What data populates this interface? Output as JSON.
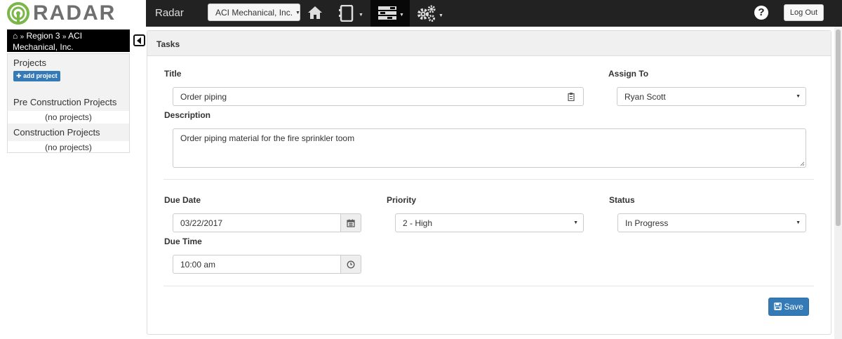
{
  "app": {
    "logo_text": "RADAR",
    "brand": "Radar",
    "company_selector": "ACI Mechanical, Inc.",
    "logout_label": "Log Out",
    "help_label": "?"
  },
  "nav": {
    "icons": [
      "home-icon",
      "device-icon",
      "list-icon",
      "gears-icon"
    ],
    "active": "list-icon"
  },
  "breadcrumb": {
    "home_icon": "home-icon",
    "region": "Region 3",
    "company": "ACI Mechanical, Inc."
  },
  "sidebar": {
    "projects_header": "Projects",
    "add_project_label": "add project",
    "sections": [
      {
        "title": "Pre Construction Projects",
        "empty_text": "(no projects)"
      },
      {
        "title": "Construction Projects",
        "empty_text": "(no projects)"
      }
    ]
  },
  "task": {
    "panel_title": "Tasks",
    "title_label": "Title",
    "title_value": "Order piping",
    "assign_label": "Assign To",
    "assign_value": "Ryan Scott",
    "description_label": "Description",
    "description_value": "Order piping material for the fire sprinkler toom",
    "due_date_label": "Due Date",
    "due_date_value": "03/22/2017",
    "priority_label": "Priority",
    "priority_value": "2 - High",
    "status_label": "Status",
    "status_value": "In Progress",
    "due_time_label": "Due Time",
    "due_time_value": "10:00 am",
    "save_label": "Save"
  },
  "colors": {
    "navbar": "#222222",
    "primary_button": "#337ab7",
    "logo_green": "#7ab648"
  }
}
